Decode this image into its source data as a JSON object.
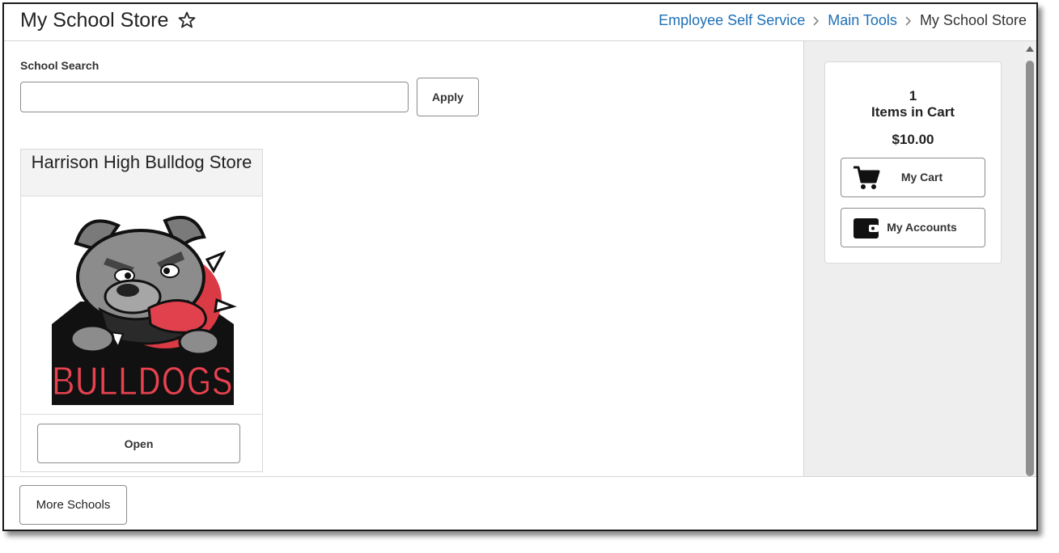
{
  "header": {
    "title": "My School Store",
    "breadcrumb": [
      "Employee Self Service",
      "Main Tools",
      "My School Store"
    ]
  },
  "search": {
    "label": "School Search",
    "value": "",
    "placeholder": "",
    "apply_label": "Apply"
  },
  "stores": [
    {
      "name": "Harrison High Bulldog Store",
      "logo_text": "BULLDOGS",
      "open_label": "Open"
    }
  ],
  "cart": {
    "count": "1",
    "label": "Items in Cart",
    "total": "$10.00",
    "my_cart_label": "My Cart",
    "my_accounts_label": "My Accounts"
  },
  "footer": {
    "more_label": "More Schools"
  },
  "colors": {
    "link": "#1e6fb5",
    "panel_bg": "#eeeeee",
    "logo_red": "#e8424f"
  }
}
